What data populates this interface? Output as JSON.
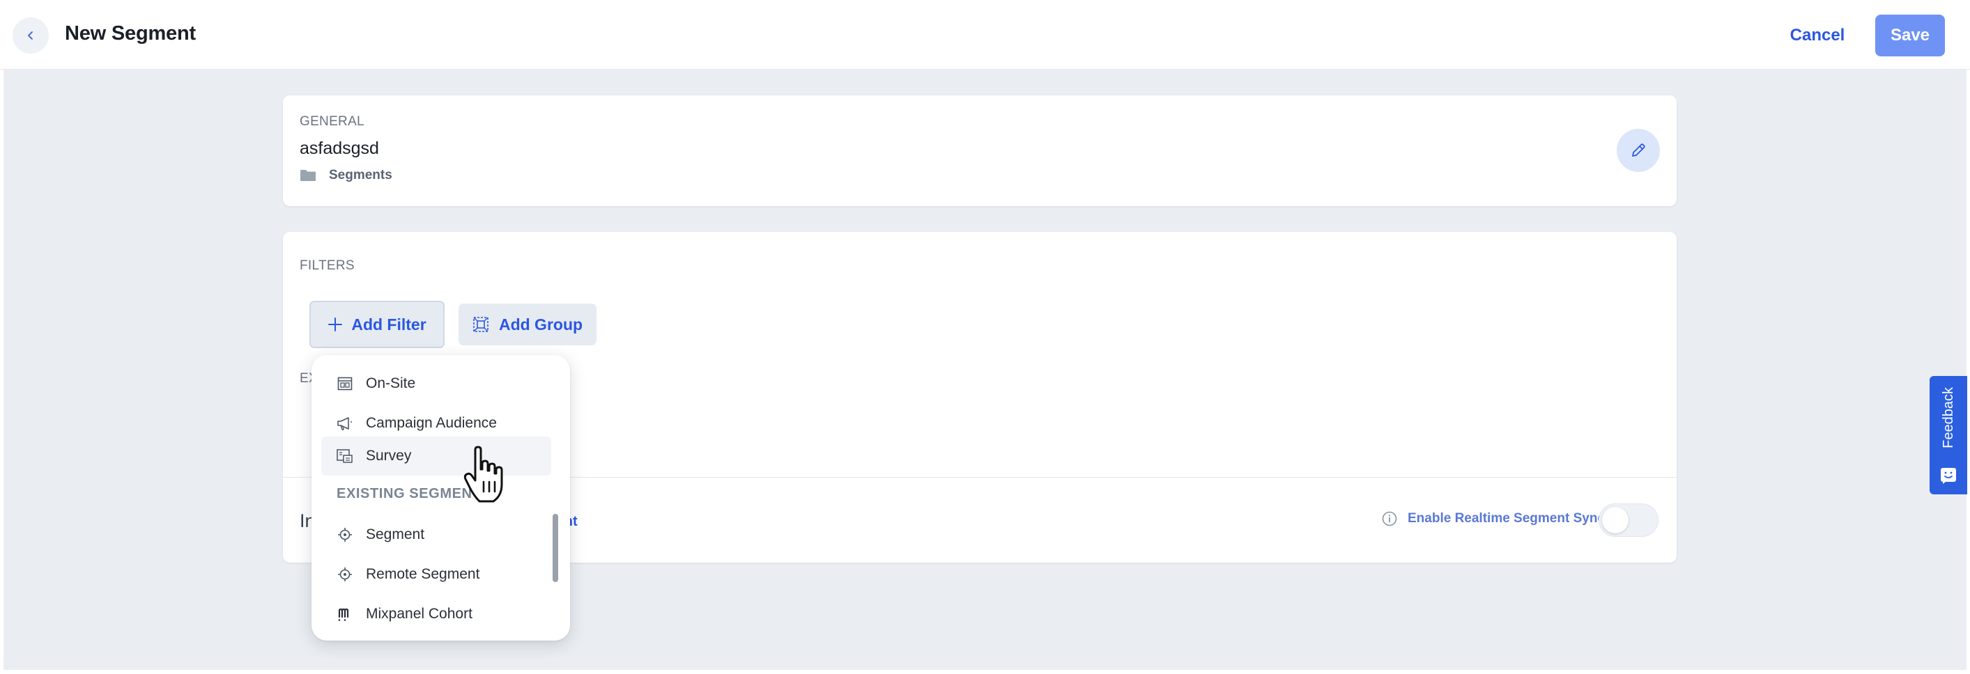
{
  "header": {
    "title": "New Segment",
    "cancel_label": "Cancel",
    "save_label": "Save"
  },
  "general": {
    "section_label": "GENERAL",
    "segment_name": "asfadsgsd",
    "folder_label": "Segments"
  },
  "filters": {
    "section_label": "FILTERS",
    "add_filter_label": "Add Filter",
    "add_group_label": "Add Group",
    "exclude_label_partial": "EX"
  },
  "footer": {
    "left_partial": "In",
    "link_partial": "alent",
    "realtime_label": "Enable Realtime Segment Sync",
    "realtime_enabled": false
  },
  "dropdown": {
    "items_top": [
      {
        "label": "On-Site",
        "icon": "onsite-icon"
      },
      {
        "label": "Campaign Audience",
        "icon": "megaphone-icon"
      },
      {
        "label": "Survey",
        "icon": "survey-icon"
      }
    ],
    "section_label": "EXISTING SEGMENTS",
    "items_bottom": [
      {
        "label": "Segment",
        "icon": "segment-target-icon"
      },
      {
        "label": "Remote Segment",
        "icon": "segment-target-icon"
      },
      {
        "label": "Mixpanel Cohort",
        "icon": "mixpanel-icon"
      }
    ],
    "hovered_item": "Survey"
  },
  "feedback": {
    "label": "Feedback"
  },
  "colors": {
    "accent": "#2b57e0",
    "save_button": "#6f93f4",
    "background": "#eaeef2",
    "feedback_tab": "#2b5fe0"
  }
}
